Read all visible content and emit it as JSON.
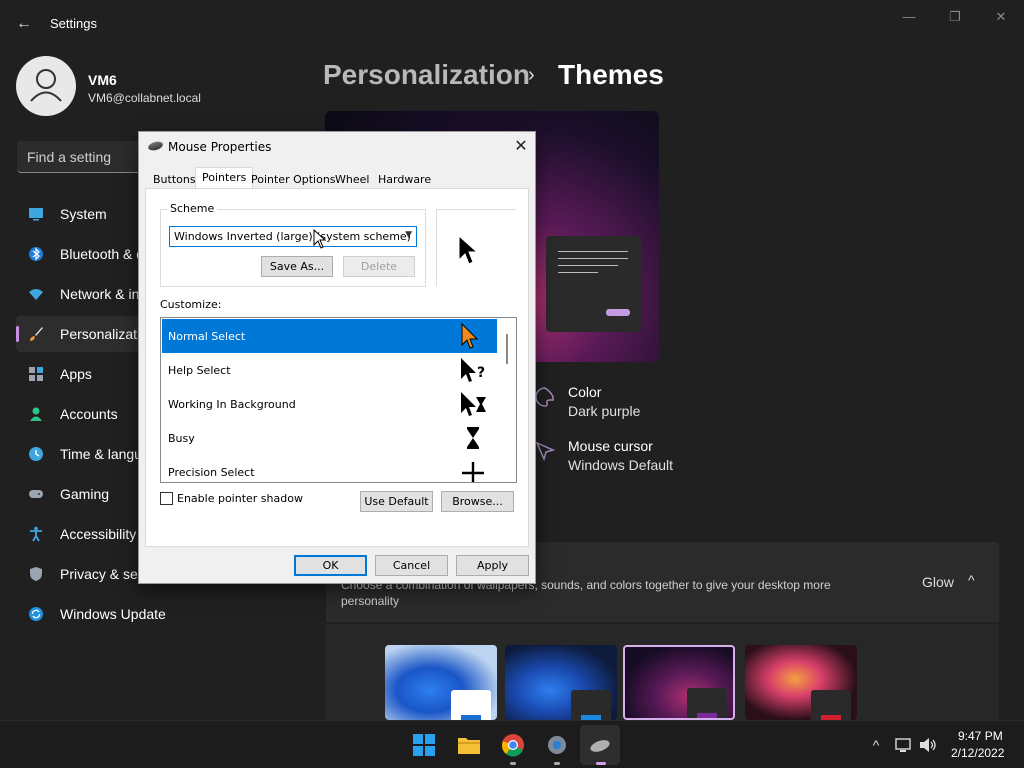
{
  "window": {
    "title": "Settings",
    "minimize_glyph": "—",
    "maximize_glyph": "❐",
    "close_glyph": "✕"
  },
  "profile": {
    "name": "VM6",
    "email": "VM6@collabnet.local"
  },
  "search": {
    "placeholder": "Find a setting"
  },
  "sidebar": {
    "items": [
      {
        "label": "System",
        "icon": "monitor-icon"
      },
      {
        "label": "Bluetooth & devices",
        "icon": "bluetooth-icon"
      },
      {
        "label": "Network & internet",
        "icon": "wifi-icon"
      },
      {
        "label": "Personalization",
        "icon": "brush-icon",
        "active": true
      },
      {
        "label": "Apps",
        "icon": "apps-icon"
      },
      {
        "label": "Accounts",
        "icon": "person-icon"
      },
      {
        "label": "Time & language",
        "icon": "clock-globe-icon"
      },
      {
        "label": "Gaming",
        "icon": "gamepad-icon"
      },
      {
        "label": "Accessibility",
        "icon": "accessibility-icon"
      },
      {
        "label": "Privacy & security",
        "icon": "shield-icon"
      },
      {
        "label": "Windows Update",
        "icon": "update-icon"
      }
    ]
  },
  "breadcrumb": {
    "parent": "Personalization",
    "separator": "›",
    "current": "Themes"
  },
  "theme_props": {
    "color_title": "Color",
    "color_value": "Dark purple",
    "cursor_title": "Mouse cursor",
    "cursor_value": "Windows Default"
  },
  "themes_panel": {
    "description": "Choose a combination of wallpapers, sounds, and colors together to give your desktop more personality",
    "current": "Glow",
    "chevron": "^"
  },
  "dialog": {
    "title": "Mouse Properties",
    "close_glyph": "✕",
    "tabs": [
      "Buttons",
      "Pointers",
      "Pointer Options",
      "Wheel",
      "Hardware"
    ],
    "active_tab": "Pointers",
    "scheme_group_label": "Scheme",
    "scheme_value": "Windows Inverted (large) (system scheme)",
    "save_as_label": "Save As...",
    "delete_label": "Delete",
    "customize_label": "Customize:",
    "list": [
      {
        "label": "Normal Select",
        "icon": "arrow-cursor-icon",
        "selected": true
      },
      {
        "label": "Help Select",
        "icon": "help-cursor-icon"
      },
      {
        "label": "Working In Background",
        "icon": "working-cursor-icon"
      },
      {
        "label": "Busy",
        "icon": "hourglass-cursor-icon"
      },
      {
        "label": "Precision Select",
        "icon": "crosshair-cursor-icon"
      }
    ],
    "shadow_label": "Enable pointer shadow",
    "shadow_checked": false,
    "use_default_label": "Use Default",
    "browse_label": "Browse...",
    "ok_label": "OK",
    "cancel_label": "Cancel",
    "apply_label": "Apply"
  },
  "taskbar": {
    "apps": [
      "start-icon",
      "file-explorer-icon",
      "chrome-icon",
      "settings-icon",
      "mouse-properties-icon"
    ],
    "time": "9:47 PM",
    "date": "2/12/2022"
  },
  "colors": {
    "accent": "#0078d7",
    "settings_accent": "#c68fe0",
    "background": "#202020"
  }
}
